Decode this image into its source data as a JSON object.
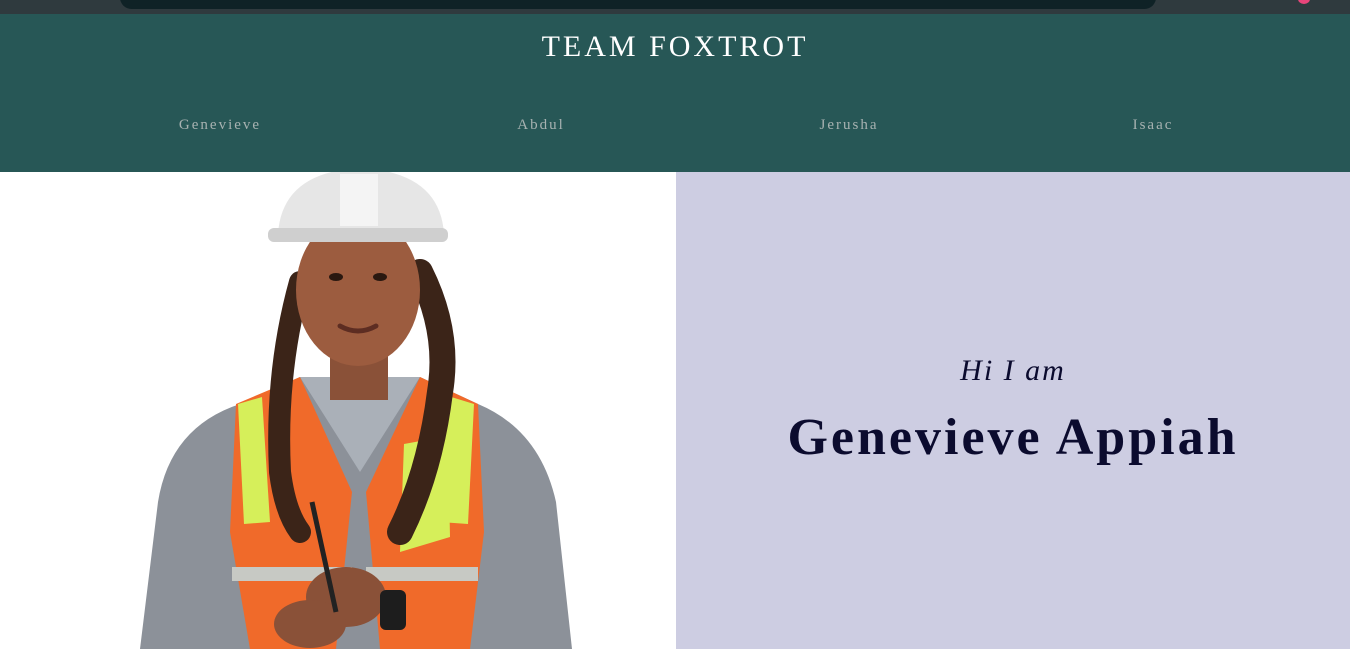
{
  "header": {
    "title": "TEAM FOXTROT"
  },
  "nav": {
    "items": [
      {
        "label": "Genevieve"
      },
      {
        "label": "Abdul"
      },
      {
        "label": "Jerusha"
      },
      {
        "label": "Isaac"
      }
    ]
  },
  "hero": {
    "greeting": "Hi I am",
    "name": "Genevieve Appiah",
    "photo": "portrait of a woman in a white hard hat and orange safety vest"
  },
  "colors": {
    "header_bg": "#275756",
    "nav_text": "#a7b2b1",
    "hero_right_bg": "#cdcde2",
    "name_text": "#0b0b2e"
  }
}
